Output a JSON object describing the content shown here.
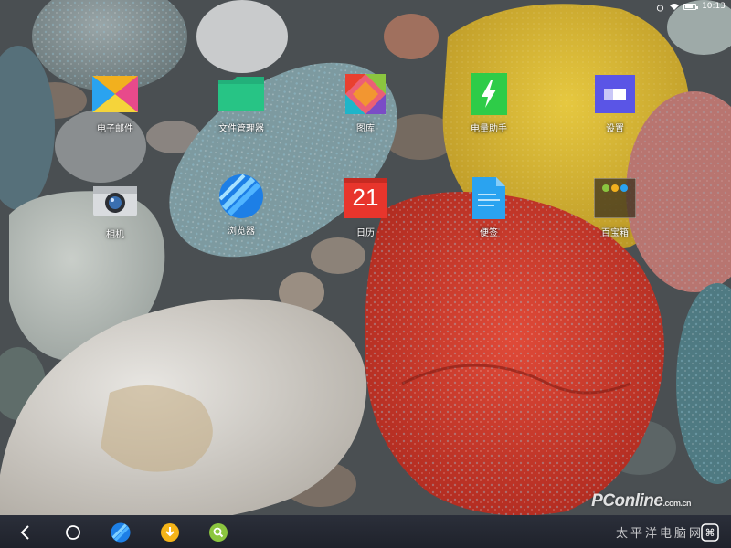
{
  "status_bar": {
    "time": "10:13"
  },
  "apps": [
    {
      "id": "email",
      "label": "电子邮件",
      "icon": "email-icon"
    },
    {
      "id": "files",
      "label": "文件管理器",
      "icon": "folder-icon"
    },
    {
      "id": "gallery",
      "label": "图库",
      "icon": "gallery-icon"
    },
    {
      "id": "battery",
      "label": "电量助手",
      "icon": "battery-assistant-icon"
    },
    {
      "id": "settings",
      "label": "设置",
      "icon": "settings-icon"
    },
    {
      "id": "camera",
      "label": "相机",
      "icon": "camera-icon"
    },
    {
      "id": "browser",
      "label": "浏览器",
      "icon": "browser-icon"
    },
    {
      "id": "calendar",
      "label": "日历",
      "icon": "calendar-icon",
      "date": "21"
    },
    {
      "id": "notes",
      "label": "便签",
      "icon": "notes-icon"
    },
    {
      "id": "toolbox",
      "label": "百宝箱",
      "icon": "toolbox-folder-icon"
    }
  ],
  "dock": {
    "items": [
      "back-icon",
      "home-icon",
      "browser-icon",
      "download-icon",
      "search-icon",
      "menu-icon"
    ]
  },
  "watermark": {
    "brand": "PConline",
    "sub": "太平洋电脑网",
    "domain": ".com.cn"
  },
  "colors": {
    "calendar_red": "#e8352c",
    "battery_green": "#2ecc48",
    "settings_purple": "#5a55e6",
    "notes_blue": "#2aa3f0",
    "folder_green": "#22b07a",
    "download_yellow": "#f5b418",
    "search_green": "#8cc63f"
  }
}
